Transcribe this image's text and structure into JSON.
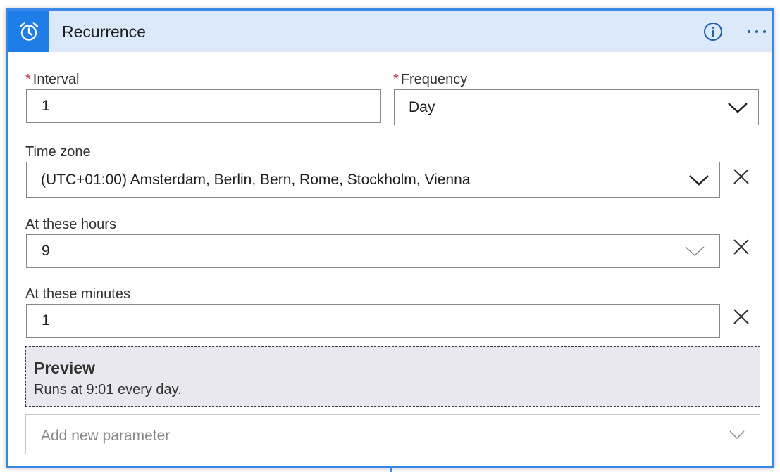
{
  "header": {
    "title": "Recurrence",
    "icon": "alarm-clock-icon",
    "accent_color": "#1f7de8"
  },
  "interval": {
    "label": "Interval",
    "required": "*",
    "value": "1"
  },
  "frequency": {
    "label": "Frequency",
    "required": "*",
    "value": "Day"
  },
  "time_zone": {
    "label": "Time zone",
    "value": "(UTC+01:00) Amsterdam, Berlin, Bern, Rome, Stockholm, Vienna"
  },
  "hours": {
    "label": "At these hours",
    "value": "9"
  },
  "minutes": {
    "label": "At these minutes",
    "value": "1"
  },
  "preview": {
    "title": "Preview",
    "text": "Runs at 9:01 every day."
  },
  "add_parameter": {
    "placeholder": "Add new parameter"
  }
}
